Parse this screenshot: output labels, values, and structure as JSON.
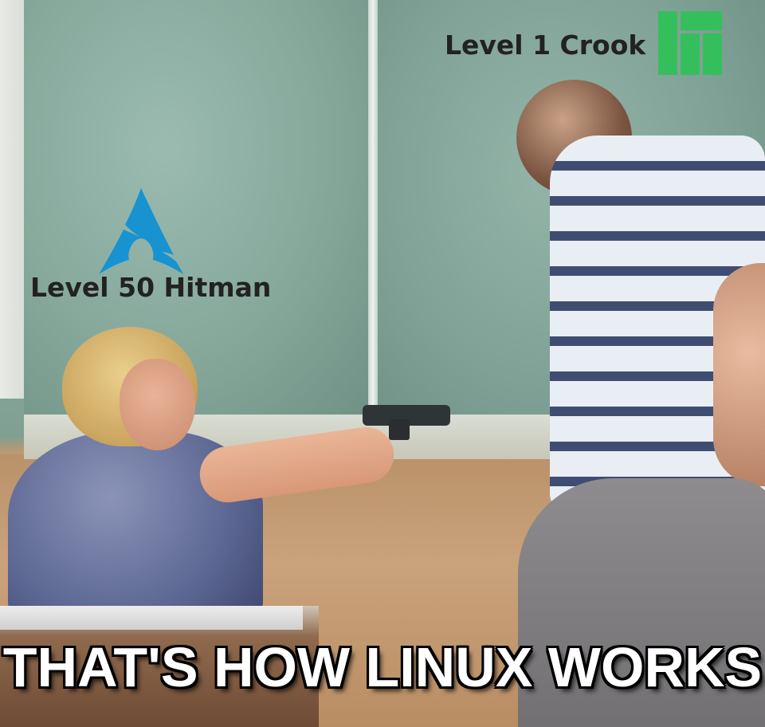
{
  "labels": {
    "left": "Level 50 Hitman",
    "right": "Level 1 Crook"
  },
  "caption": "THAT'S HOW LINUX WORKS",
  "icons": {
    "left_logo": "arch-linux-logo-icon",
    "right_logo": "manjaro-logo-icon"
  },
  "colors": {
    "arch_blue": "#1793d1",
    "manjaro_green": "#35bf5c",
    "caption_text": "#ffffff",
    "label_text": "#222222"
  }
}
